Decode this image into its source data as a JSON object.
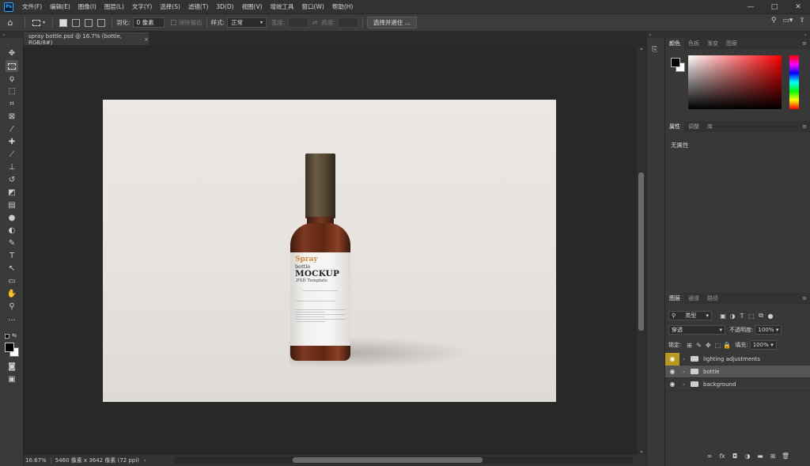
{
  "app": {
    "logo": "Ps"
  },
  "menu": [
    "文件(F)",
    "编辑(E)",
    "图像(I)",
    "图层(L)",
    "文字(Y)",
    "选择(S)",
    "滤镜(T)",
    "3D(D)",
    "视图(V)",
    "增效工具",
    "窗口(W)",
    "帮助(H)"
  ],
  "window_controls": {
    "minimize": "—",
    "maximize": "□",
    "close": "✕"
  },
  "options": {
    "feather_label": "羽化:",
    "feather_value": "0 像素",
    "antialias_label": "消除锯齿",
    "style_label": "样式:",
    "style_value": "正常",
    "width_label": "宽度:",
    "height_label": "高度:",
    "select_mask_button": "选择并遮住 ..."
  },
  "document": {
    "tab_title": "spray bottle.psd @ 16.7% (bottle, RGB/8#)",
    "tab_close": "×",
    "label_spray": "Spray",
    "label_bottle": "bottle",
    "label_mockup": "MOCKUP",
    "label_psd": ".PSD Template"
  },
  "status": {
    "zoom": "16.67%",
    "doc_info": "5460 像素 x 3642 像素 (72 ppi)",
    "arrow": "›"
  },
  "panels": {
    "color_tabs": [
      "颜色",
      "色板",
      "渐变",
      "图案"
    ],
    "properties_tabs": [
      "属性",
      "调整",
      "库"
    ],
    "properties_text": "无属性",
    "layers_tabs": [
      "图层",
      "通道",
      "路径"
    ],
    "filter_label": "类型",
    "blend_mode": "穿透",
    "opacity_label": "不透明度:",
    "opacity_value": "100%",
    "lock_label": "锁定:",
    "fill_label": "填充:",
    "fill_value": "100%"
  },
  "layers": [
    {
      "name": "lighting adjustments",
      "highlight": true,
      "selected": false
    },
    {
      "name": "bottle",
      "highlight": false,
      "selected": true
    },
    {
      "name": "background",
      "highlight": false,
      "selected": false
    }
  ],
  "colors": {
    "accent": "#31a8ff",
    "eye_highlight": "#b89a1e",
    "foreground": "#000000",
    "background": "#ffffff"
  }
}
